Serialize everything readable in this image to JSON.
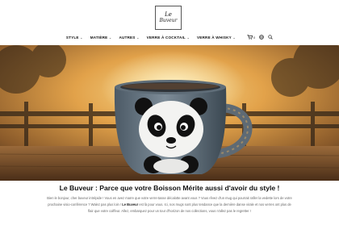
{
  "brand": {
    "logo_line1": "Le",
    "logo_line2": "Buveur"
  },
  "nav": {
    "items": [
      {
        "label": "STYLE",
        "has_dropdown": true
      },
      {
        "label": "MATIÈRE",
        "has_dropdown": true
      },
      {
        "label": "AUTRES",
        "has_dropdown": true
      },
      {
        "label": "VERRE À COCKTAIL",
        "has_dropdown": true
      },
      {
        "label": "VERRE À WHISKY",
        "has_dropdown": true
      }
    ],
    "cart_count": "0",
    "icons": [
      "cart-icon",
      "globe-icon",
      "search-icon"
    ]
  },
  "hero": {
    "subject": "panda mug"
  },
  "intro": {
    "title": "Le Buveur : Parce que votre Boisson Mérite aussi d'avoir du style !",
    "text_a": "Bien le bonjour, cher buveur intrépide ! Vous en avez marre que votre verre-tasse décalotte avant vous ? Vous rêvez d'un mug qui pourrait rafler la vedette lors de votre prochaine visio-conférence ? Walez pas plus loin ! ",
    "brand_inline": "Le Buveur",
    "text_b": " est là pour vous. Ici, nos mugs sont plus tendance que la dernière danse virale et nos verres ont plus de flair que votre coiffeur. Allez, embarquez pour un tour d'horizon de nos collections, vous n'allez pas le regretter !"
  },
  "colors": {
    "accent": "#d98c2b",
    "text": "#111111",
    "muted": "#666666"
  }
}
